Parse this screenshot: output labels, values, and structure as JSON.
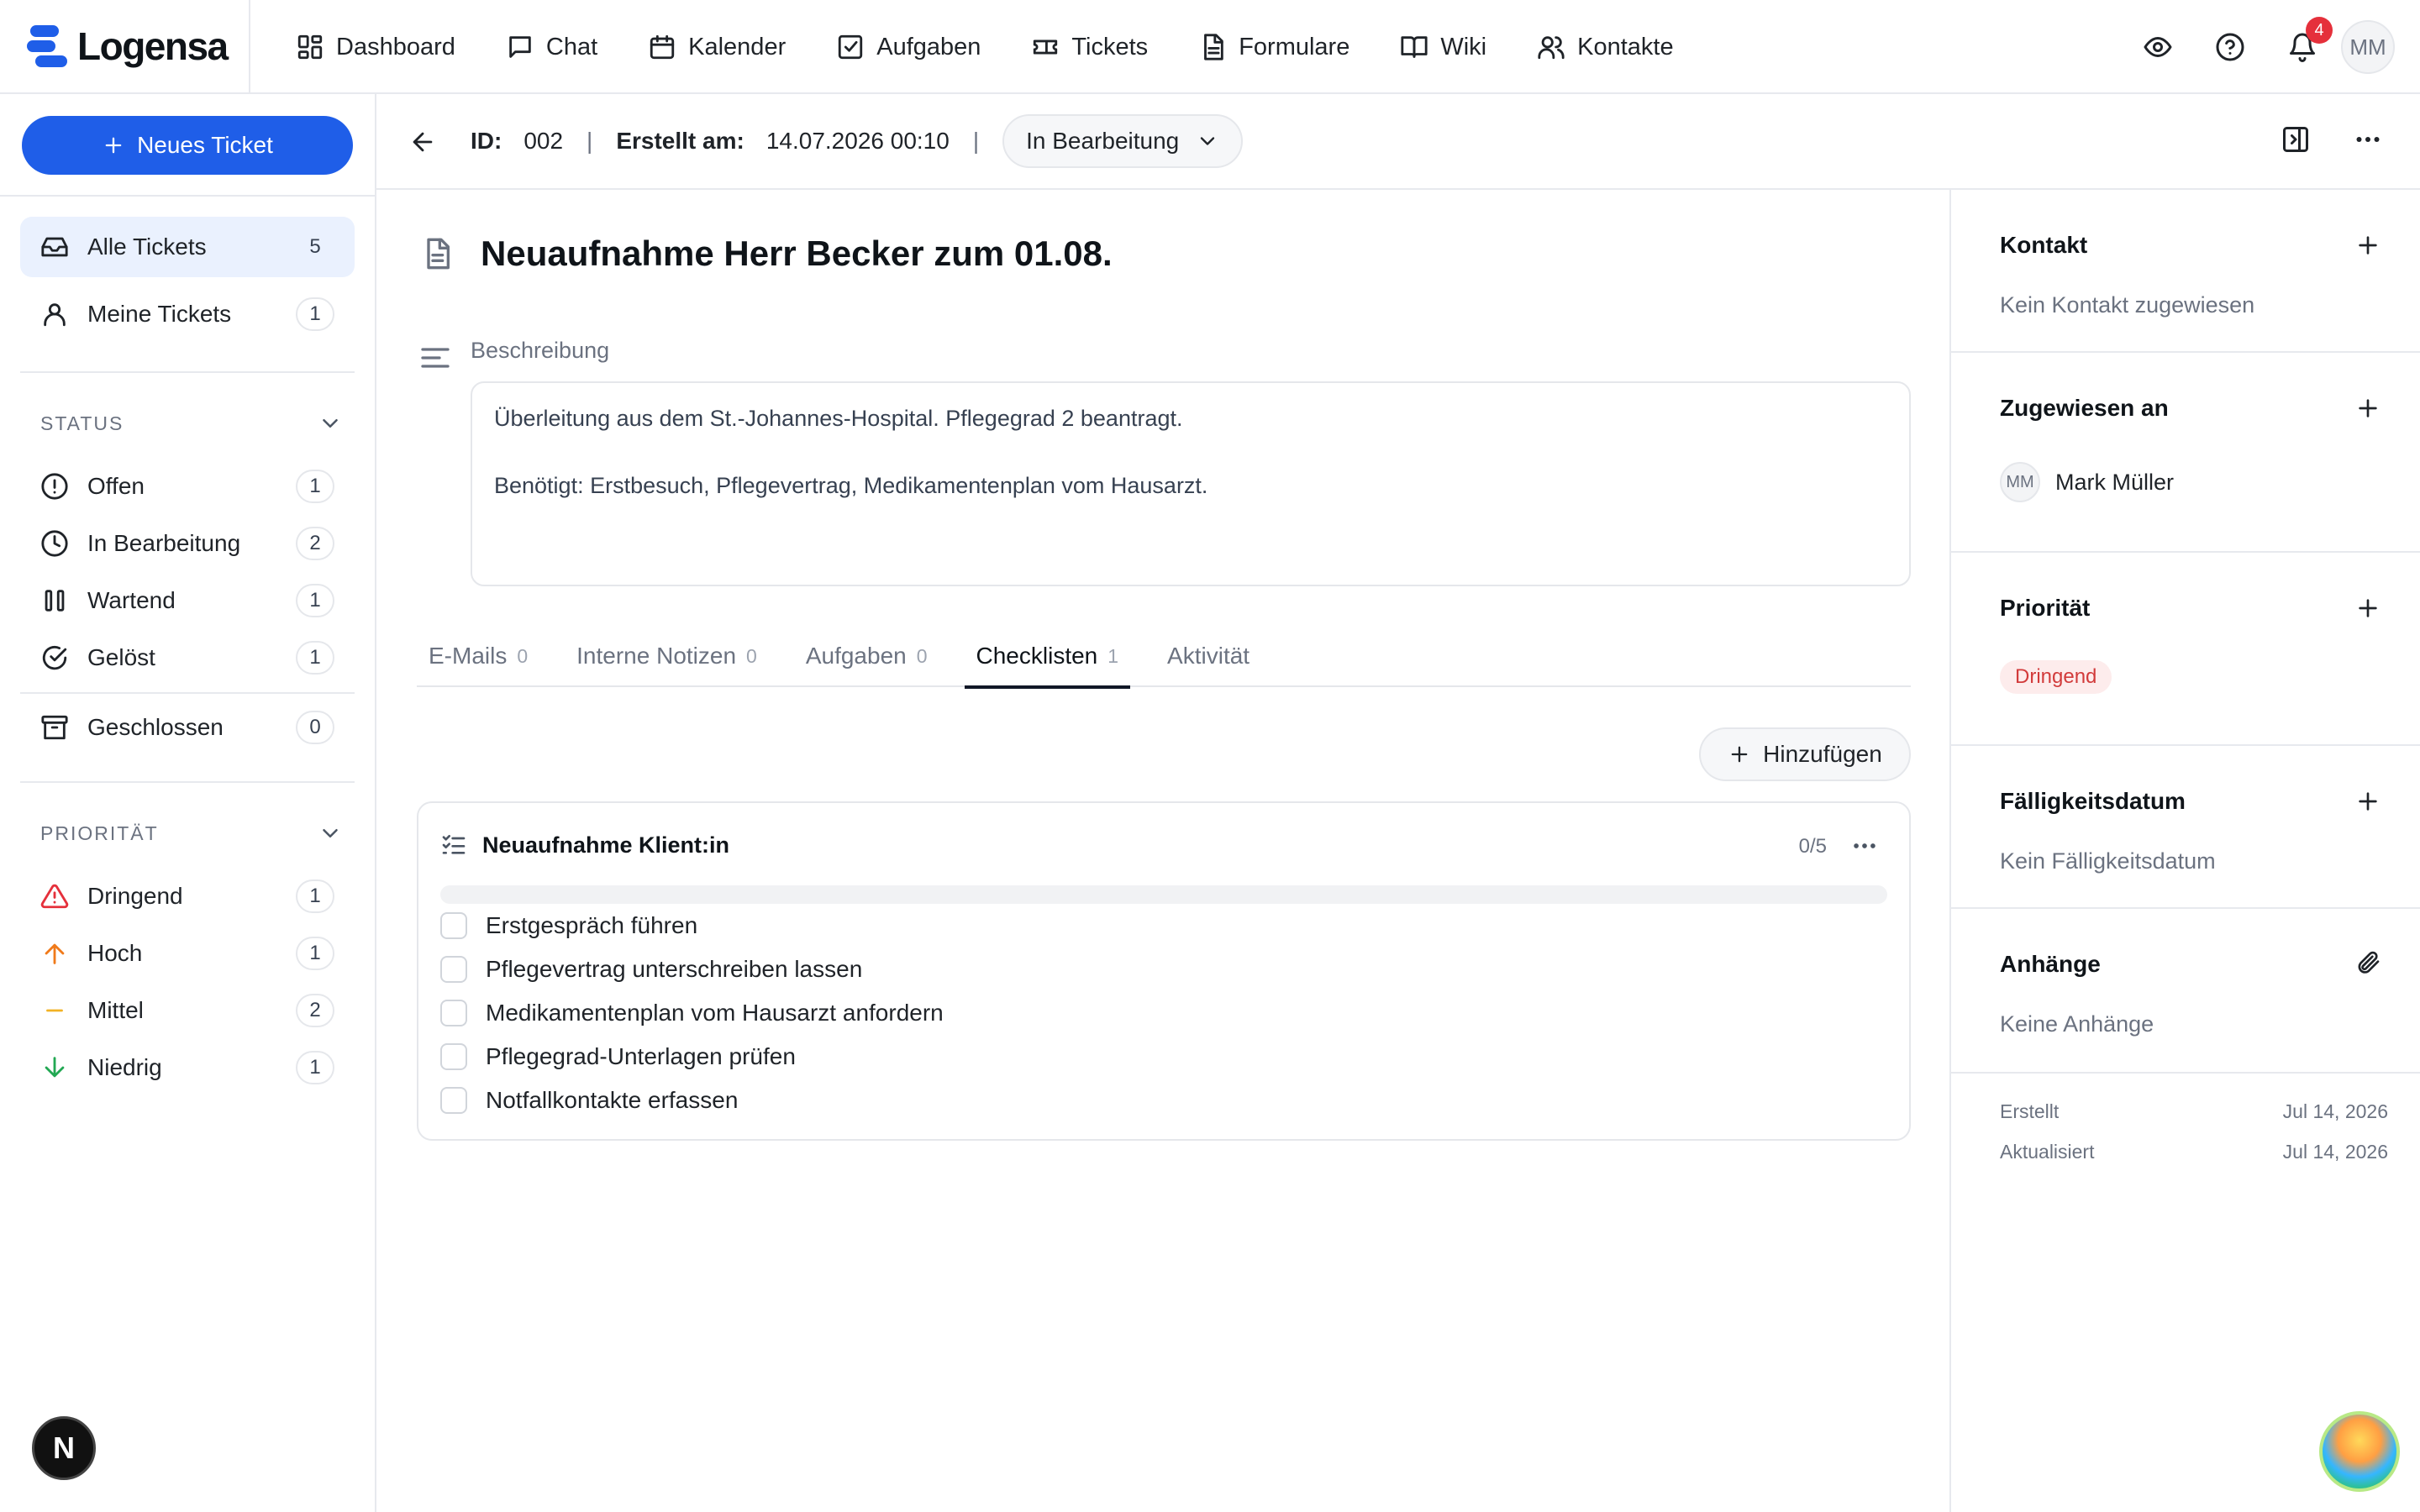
{
  "app": {
    "logo_text": "Logensa",
    "colors": {
      "brand": "#1f5ee8",
      "danger": "#e5303b",
      "high": "#f07a1a",
      "medium": "#f2b224",
      "low": "#22a853"
    }
  },
  "topnav": {
    "items": [
      {
        "label": "Dashboard",
        "icon": "dashboard-icon"
      },
      {
        "label": "Chat",
        "icon": "chat-icon"
      },
      {
        "label": "Kalender",
        "icon": "calendar-icon"
      },
      {
        "label": "Aufgaben",
        "icon": "task-icon"
      },
      {
        "label": "Tickets",
        "icon": "ticket-icon"
      },
      {
        "label": "Formulare",
        "icon": "form-icon"
      },
      {
        "label": "Wiki",
        "icon": "book-icon"
      },
      {
        "label": "Kontakte",
        "icon": "contacts-icon"
      }
    ],
    "notifications_count": "4",
    "user_initials": "MM"
  },
  "sidebar": {
    "new_ticket_label": "Neues Ticket",
    "views": [
      {
        "label": "Alle Tickets",
        "count": "5",
        "icon": "inbox-icon"
      },
      {
        "label": "Meine Tickets",
        "count": "1",
        "icon": "user-icon"
      }
    ],
    "status_header": "STATUS",
    "status": [
      {
        "label": "Offen",
        "count": "1",
        "icon": "alert-circle-icon"
      },
      {
        "label": "In Bearbeitung",
        "count": "2",
        "icon": "clock-icon"
      },
      {
        "label": "Wartend",
        "count": "1",
        "icon": "pause-icon"
      },
      {
        "label": "Gelöst",
        "count": "1",
        "icon": "check-circle-icon"
      },
      {
        "label": "Geschlossen",
        "count": "0",
        "icon": "archive-icon"
      }
    ],
    "priority_header": "PRIORITÄT",
    "priority": [
      {
        "label": "Dringend",
        "count": "1",
        "icon": "warning-triangle-icon"
      },
      {
        "label": "Hoch",
        "count": "1",
        "icon": "arrow-up-icon"
      },
      {
        "label": "Mittel",
        "count": "2",
        "icon": "dash-icon"
      },
      {
        "label": "Niedrig",
        "count": "1",
        "icon": "arrow-down-icon"
      }
    ]
  },
  "ticket": {
    "id_label": "ID:",
    "id": "002",
    "separator": "|",
    "created_label": "Erstellt am:",
    "created": "14.07.2026 00:10",
    "status": "In Bearbeitung",
    "title": "Neuaufnahme Herr Becker zum 01.08.",
    "description_label": "Beschreibung",
    "description": "Überleitung aus dem St.-Johannes-Hospital. Pflegegrad 2 beantragt.\n\nBenötigt: Erstbesuch, Pflegevertrag, Medikamentenplan vom Hausarzt."
  },
  "tabs": [
    {
      "label": "E-Mails",
      "count": "0"
    },
    {
      "label": "Interne Notizen",
      "count": "0"
    },
    {
      "label": "Aufgaben",
      "count": "0"
    },
    {
      "label": "Checklisten",
      "count": "1",
      "active": true
    },
    {
      "label": "Aktivität",
      "count": ""
    }
  ],
  "checklist": {
    "add_label": "Hinzufügen",
    "title": "Neuaufnahme Klient:in",
    "progress_text": "0/5",
    "progress_fraction": 0,
    "items": [
      "Erstgespräch führen",
      "Pflegevertrag unterschreiben lassen",
      "Medikamentenplan vom Hausarzt anfordern",
      "Pflegegrad-Unterlagen prüfen",
      "Notfallkontakte erfassen"
    ]
  },
  "details": {
    "contact_title": "Kontakt",
    "contact_value": "Kein Kontakt zugewiesen",
    "assignee_title": "Zugewiesen an",
    "assignee_initials": "MM",
    "assignee_name": "Mark Müller",
    "priority_title": "Priorität",
    "priority_value": "Dringend",
    "due_title": "Fälligkeitsdatum",
    "due_value": "Kein Fälligkeitsdatum",
    "attachments_title": "Anhänge",
    "attachments_value": "Keine Anhänge",
    "created_label": "Erstellt",
    "created_value": "Jul 14, 2026",
    "updated_label": "Aktualisiert",
    "updated_value": "Jul 14, 2026"
  },
  "floating": {
    "dev_badge_letter": "N"
  }
}
